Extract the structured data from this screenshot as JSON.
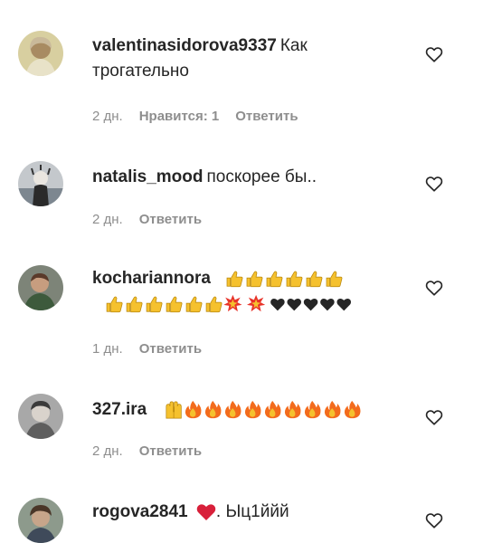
{
  "comments": [
    {
      "username": "valentinasidorova9337",
      "text": "Как трогательно",
      "time": "2 дн.",
      "likes": "Нравится: 1",
      "reply": "Ответить",
      "avatar": "portrait-icon"
    },
    {
      "username": "natalis_mood",
      "text": "поскорее бы..",
      "time": "2 дн.",
      "likes": "",
      "reply": "Ответить",
      "avatar": "portrait-icon"
    },
    {
      "username": "kochariannora",
      "text": "",
      "emoji": [
        "thumbs-up-emoji",
        "thumbs-up-emoji",
        "thumbs-up-emoji",
        "thumbs-up-emoji",
        "thumbs-up-emoji",
        "thumbs-up-emoji",
        "thumbs-up-emoji",
        "thumbs-up-emoji",
        "thumbs-up-emoji",
        "thumbs-up-emoji",
        "thumbs-up-emoji",
        "thumbs-up-emoji",
        "collision-emoji",
        "collision-emoji",
        "black-heart-emoji",
        "black-heart-emoji",
        "black-heart-emoji",
        "black-heart-emoji",
        "black-heart-emoji"
      ],
      "time": "1 дн.",
      "likes": "",
      "reply": "Ответить",
      "avatar": "portrait-icon"
    },
    {
      "username": "327.ira",
      "text": "",
      "emoji": [
        "raising-hands-emoji",
        "fire-emoji",
        "fire-emoji",
        "fire-emoji",
        "fire-emoji",
        "fire-emoji",
        "fire-emoji",
        "fire-emoji",
        "fire-emoji",
        "fire-emoji"
      ],
      "time": "2 дн.",
      "likes": "",
      "reply": "Ответить",
      "avatar": "portrait-icon"
    },
    {
      "username": "rogova2841",
      "text": ". Ыц1ййй",
      "emoji_before": "red-heart-emoji",
      "time": "",
      "likes": "",
      "reply": "",
      "avatar": "portrait-icon"
    }
  ],
  "icons": {
    "like": "heart-outline-icon"
  },
  "colors": {
    "text": "#262626",
    "meta": "#8e8e8e",
    "thumb": "#f5c12e",
    "fire": "#f36b1c",
    "collision": "#e8332a",
    "heart_red": "#d8203a",
    "heart_black": "#262626"
  }
}
